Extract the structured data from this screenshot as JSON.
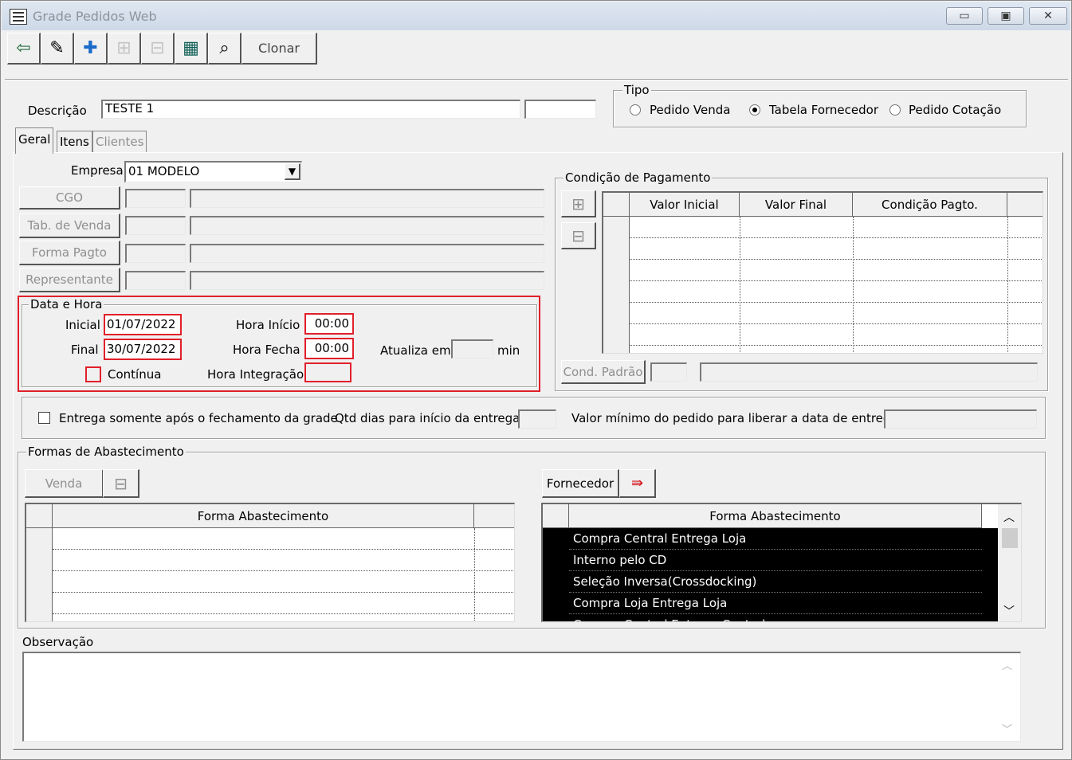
{
  "window": {
    "title": "Grade Pedidos Web",
    "controls": {
      "minimize": "▭",
      "maximize": "▣",
      "close": "✕"
    }
  },
  "toolbar": {
    "buttons": [
      {
        "icon": "exit-door-icon",
        "glyph": "⇦"
      },
      {
        "icon": "eraser-icon",
        "glyph": "✎"
      },
      {
        "icon": "add-record-icon",
        "glyph": "✚"
      },
      {
        "icon": "add-row-icon",
        "glyph": "⊞"
      },
      {
        "icon": "remove-row-icon",
        "glyph": "⊟"
      },
      {
        "icon": "sheet-icon",
        "glyph": "▦"
      },
      {
        "icon": "binoculars-icon",
        "glyph": "⌕"
      }
    ],
    "clone_label": "Clonar"
  },
  "header": {
    "descricao_label": "Descrição",
    "descricao_value": "TESTE 1",
    "extra_value": "",
    "tipo": {
      "title": "Tipo",
      "options": [
        "Pedido Venda",
        "Tabela Fornecedor",
        "Pedido Cotação"
      ],
      "selected": "Tabela Fornecedor"
    }
  },
  "tabs": [
    "Geral",
    "Itens",
    "Clientes"
  ],
  "geral": {
    "empresa_label": "Empresa",
    "empresa_value": "01 MODELO",
    "lookup_buttons": [
      "CGO",
      "Tab. de Venda",
      "Forma Pagto",
      "Representante"
    ],
    "data_hora": {
      "title": "Data e Hora",
      "inicial_label": "Inicial",
      "inicial_value": "01/07/2022",
      "final_label": "Final",
      "final_value": "30/07/2022",
      "continua_label": "Contínua",
      "hora_inicio_label": "Hora Início",
      "hora_inicio_value": "00:00",
      "hora_fecha_label": "Hora Fecha",
      "hora_fecha_value": "00:00",
      "hora_integracao_label": "Hora Integração",
      "hora_integracao_value": "",
      "atualiza_label": "Atualiza em",
      "atualiza_value": "",
      "min_label": "min"
    },
    "condicao_pagamento": {
      "title": "Condição de Pagamento",
      "columns": [
        "Valor Inicial",
        "Valor Final",
        "Condição Pagto."
      ],
      "cond_padrao_label": "Cond. Padrão"
    },
    "entrega": {
      "checkbox_label": "Entrega somente após o fechamento da grade",
      "qtd_dias_label": "Qtd dias para início da entrega",
      "valor_minimo_label": "Valor mínimo do pedido para liberar a data de entrega"
    },
    "formas_abastecimento": {
      "title": "Formas de Abastecimento",
      "venda_button": "Venda",
      "fornecedor_button": "Fornecedor",
      "left_column": "Forma Abastecimento",
      "right_column": "Forma Abastecimento",
      "right_rows": [
        "Compra Central Entrega Loja",
        "Interno pelo CD",
        "Seleção Inversa(Crossdocking)",
        "Compra Loja Entrega Loja",
        "Compra Central Entrega Central"
      ]
    },
    "observacao_label": "Observação",
    "observacao_value": ""
  }
}
